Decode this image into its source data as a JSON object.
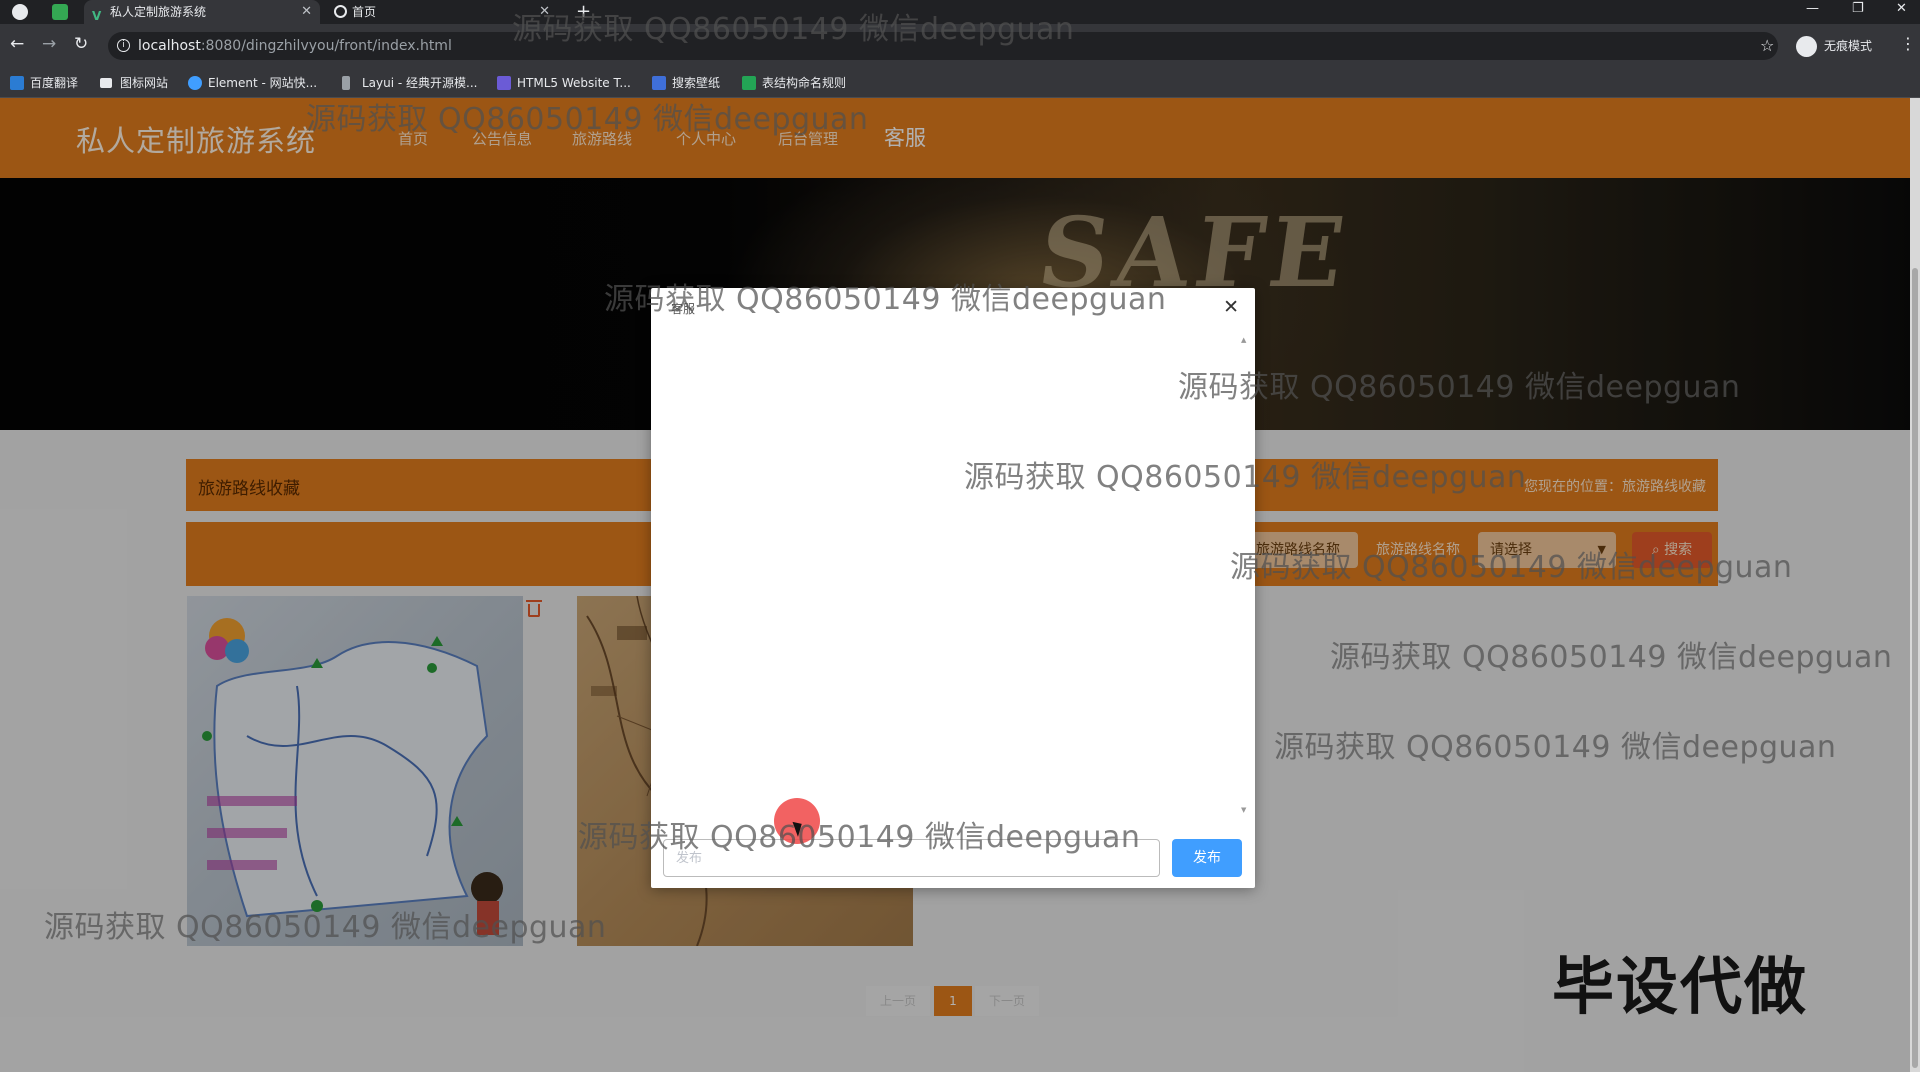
{
  "browser": {
    "tabs": [
      {
        "label": "私人定制旅游系统",
        "active": true
      },
      {
        "label": "首页",
        "active": false
      }
    ],
    "url_host": "localhost",
    "url_path": ":8080/dingzhilvyou/front/index.html",
    "profile_label": "无痕模式",
    "bookmarks": [
      "百度翻译",
      "图标网站",
      "Element - 网站快...",
      "Layui - 经典开源模...",
      "HTML5 Website T...",
      "搜索壁纸",
      "表结构命名规则"
    ]
  },
  "site": {
    "brand": "私人定制旅游系统",
    "nav": [
      "首页",
      "公告信息",
      "旅游路线",
      "个人中心",
      "后台管理"
    ],
    "nav_service": "客服",
    "banner_text": "SAFE"
  },
  "section": {
    "title": "旅游路线收藏",
    "location": "您现在的位置：旅游路线收藏"
  },
  "search": {
    "field1": "旅游路线名称",
    "field2": "旅游路线名称",
    "select": "请选择",
    "button": "搜索"
  },
  "pagination": {
    "prev": "上一页",
    "current": "1",
    "next": "下一页"
  },
  "dialog": {
    "title": "客服",
    "input_placeholder": "发布",
    "send_label": "发布"
  },
  "watermark": "源码获取 QQ86050149 微信deepguan",
  "promo": "毕设代做",
  "colors": {
    "nav_orange": "#e07b1e",
    "send_blue": "#409eff",
    "search_red": "#e35a2a"
  }
}
